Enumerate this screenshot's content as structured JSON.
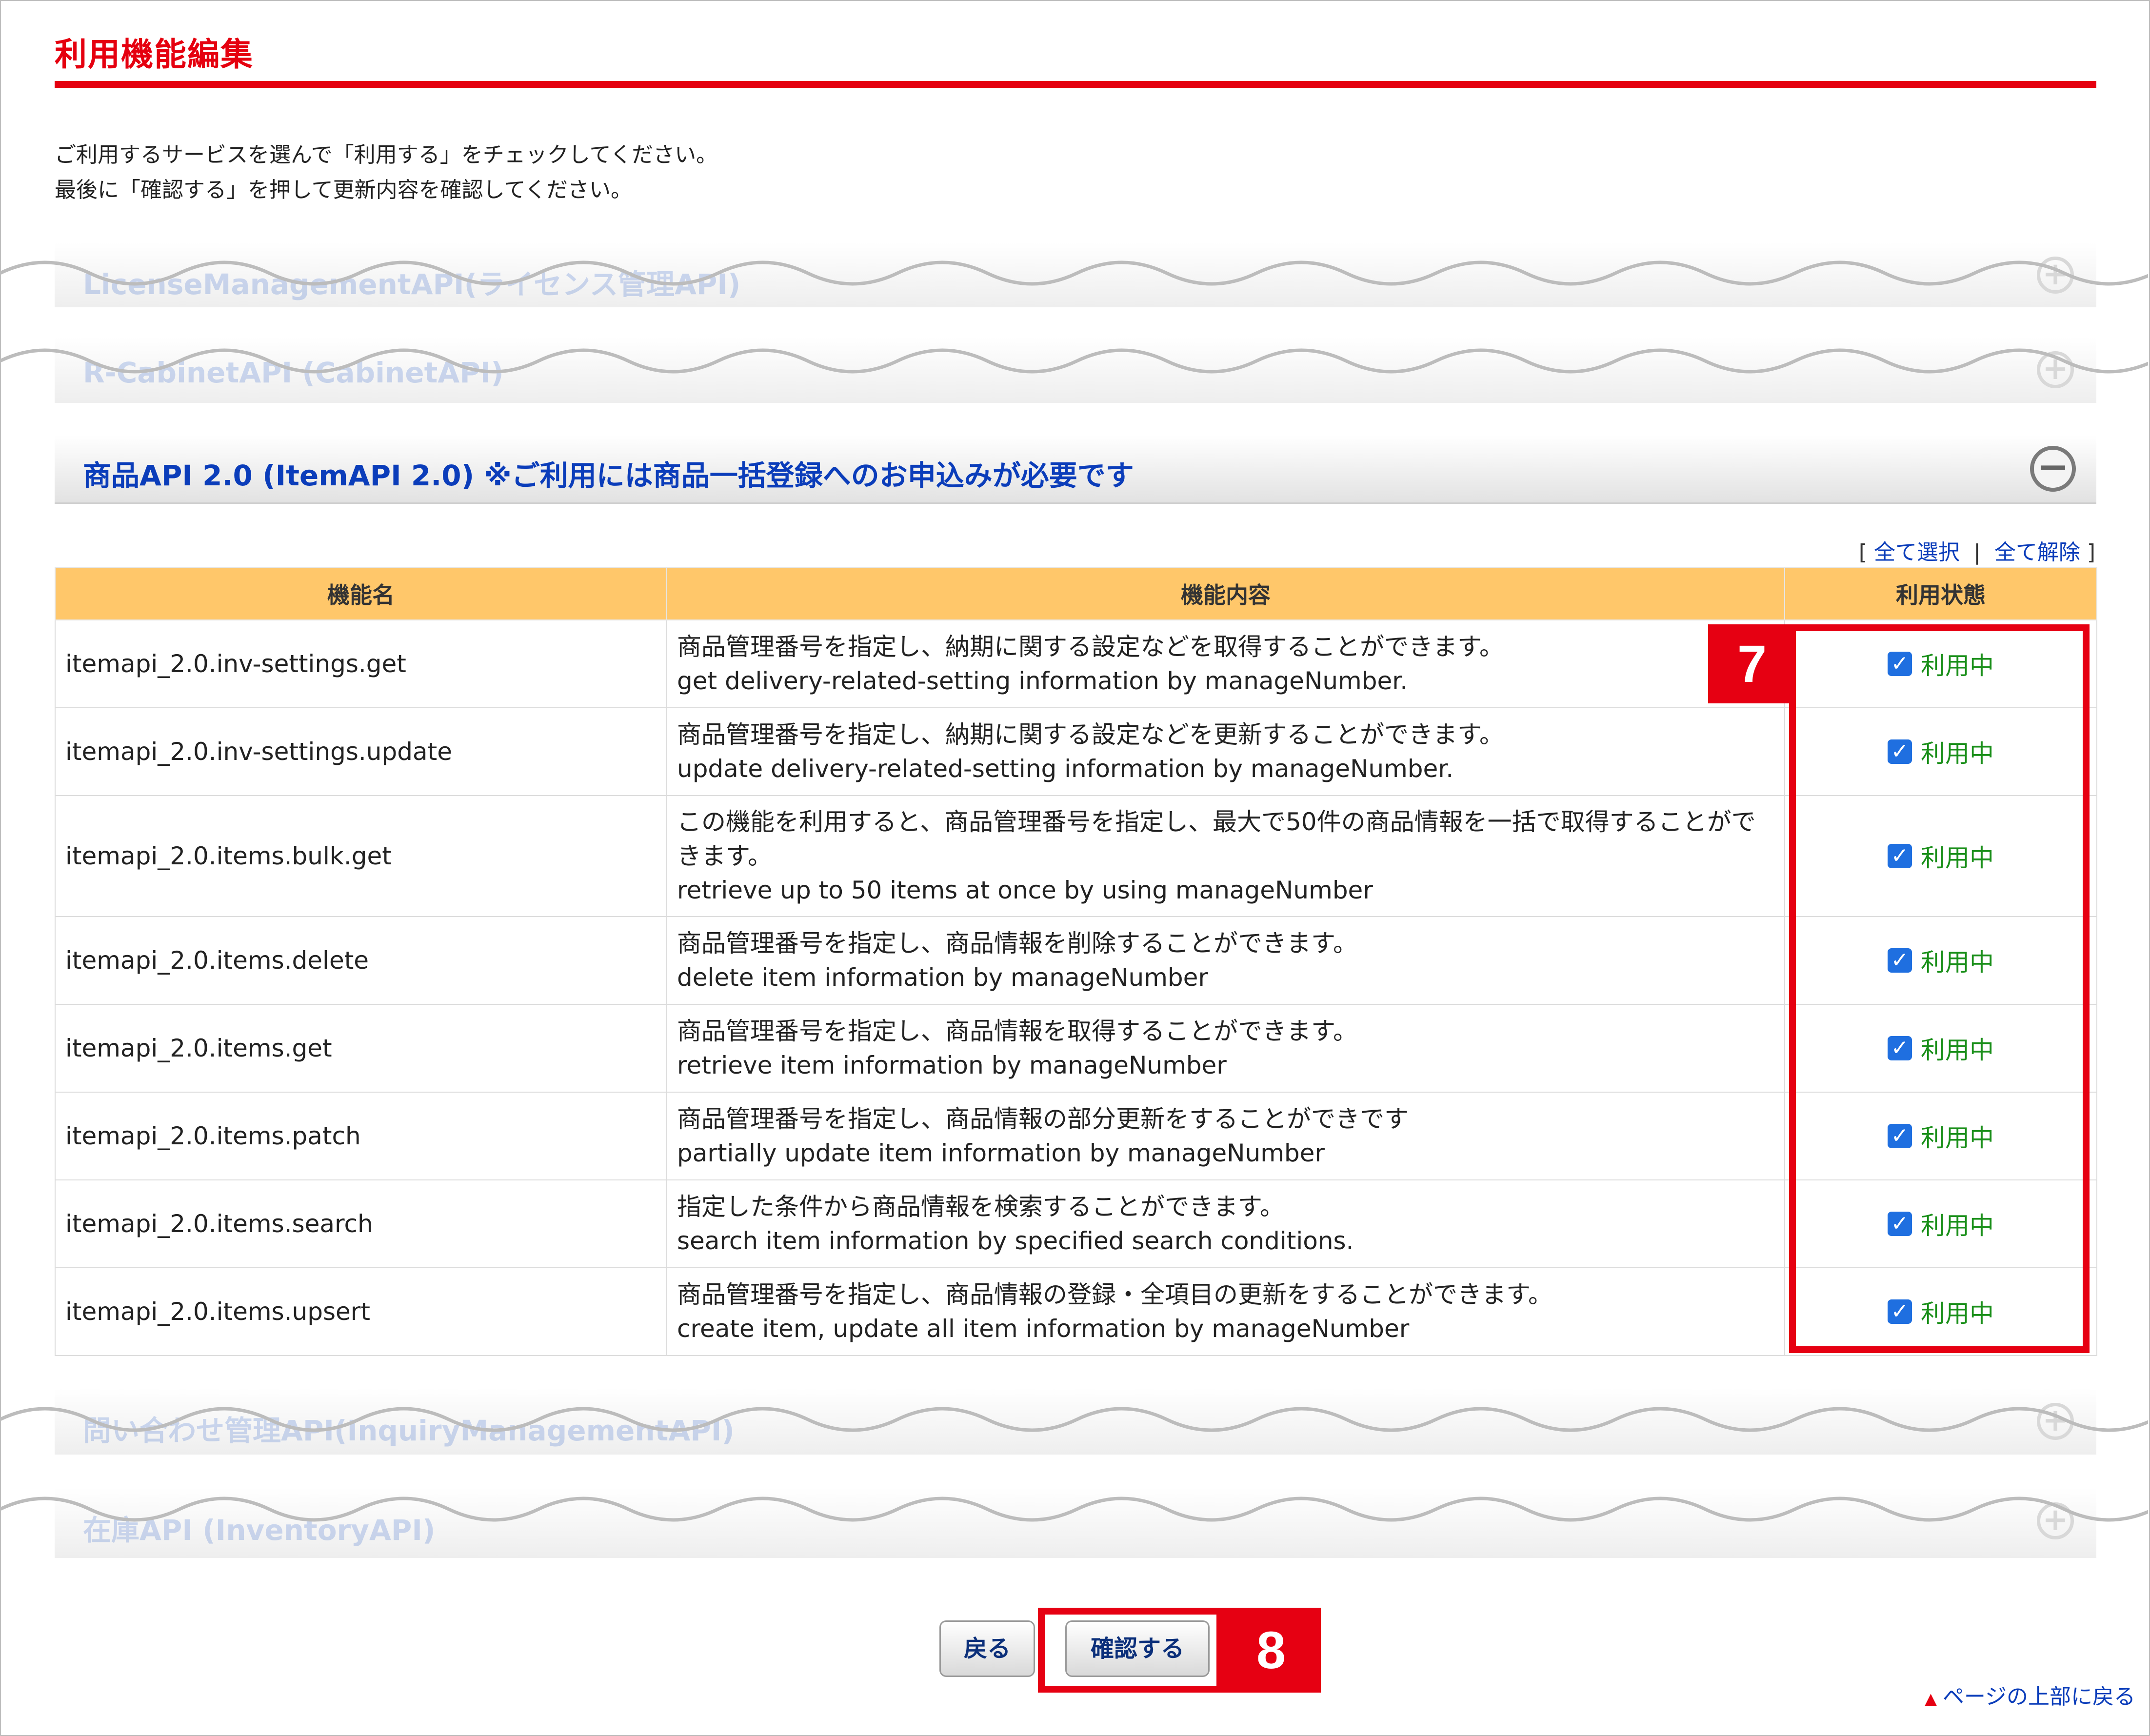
{
  "page": {
    "title": "利用機能編集",
    "intro": [
      "ご利用するサービスを選んで「利用する」をチェックしてください。",
      "最後に「確認する」を押して更新内容を確認してください。"
    ]
  },
  "panels": {
    "license": "LicenseManagementAPI(ライセンス管理API)",
    "cabinet": "R-CabinetAPI (CabinetAPI)",
    "item": "商品API 2.0 (ItemAPI 2.0) ※ご利用には商品一括登録へのお申込みが必要です",
    "inquiry": "問い合わせ管理API(InquiryManagementAPI)",
    "inventory": "在庫API (InventoryAPI)"
  },
  "select": {
    "open": "[",
    "all": "全て選択",
    "sep": "|",
    "none": "全て解除",
    "close": "]"
  },
  "table": {
    "headers": [
      "機能名",
      "機能内容",
      "利用状態"
    ],
    "rows": [
      {
        "name": "itemapi_2.0.inv-settings.get",
        "desc_ja": "商品管理番号を指定し、納期に関する設定などを取得することができます。",
        "desc_en": "get delivery-related-setting information by manageNumber.",
        "status": "利用中"
      },
      {
        "name": "itemapi_2.0.inv-settings.update",
        "desc_ja": "商品管理番号を指定し、納期に関する設定などを更新することができます。",
        "desc_en": "update delivery-related-setting information by manageNumber.",
        "status": "利用中"
      },
      {
        "name": "itemapi_2.0.items.bulk.get",
        "desc_ja": "この機能を利用すると、商品管理番号を指定し、最大で50件の商品情報を一括で取得することができます。",
        "desc_en": "retrieve up to 50 items at once by using manageNumber",
        "status": "利用中"
      },
      {
        "name": "itemapi_2.0.items.delete",
        "desc_ja": "商品管理番号を指定し、商品情報を削除することができます。",
        "desc_en": "delete item information by manageNumber",
        "status": "利用中"
      },
      {
        "name": "itemapi_2.0.items.get",
        "desc_ja": "商品管理番号を指定し、商品情報を取得することができます。",
        "desc_en": "retrieve item information by manageNumber",
        "status": "利用中"
      },
      {
        "name": "itemapi_2.0.items.patch",
        "desc_ja": "商品管理番号を指定し、商品情報の部分更新をすることができです",
        "desc_en": "partially update item information by manageNumber",
        "status": "利用中"
      },
      {
        "name": "itemapi_2.0.items.search",
        "desc_ja": "指定した条件から商品情報を検索することができます。",
        "desc_en": "search item information by specified search conditions.",
        "status": "利用中"
      },
      {
        "name": "itemapi_2.0.items.upsert",
        "desc_ja": "商品管理番号を指定し、商品情報の登録・全項目の更新をすることができます。",
        "desc_en": "create item, update all item information by manageNumber",
        "status": "利用中"
      }
    ]
  },
  "buttons": {
    "back": "戻る",
    "confirm": "確認する"
  },
  "badges": {
    "step7": "7",
    "step8": "8"
  },
  "page_top": "ページの上部に戻る",
  "icons": {
    "expand": "+",
    "collapse": "−",
    "check": "✓",
    "up_triangle": "▲"
  },
  "colors": {
    "accent_red": "#e5000f",
    "link_blue": "#0b3dba",
    "header_orange": "#ffc76a",
    "status_green": "#1a8f1a",
    "checkbox_blue": "#1f6fe0"
  }
}
